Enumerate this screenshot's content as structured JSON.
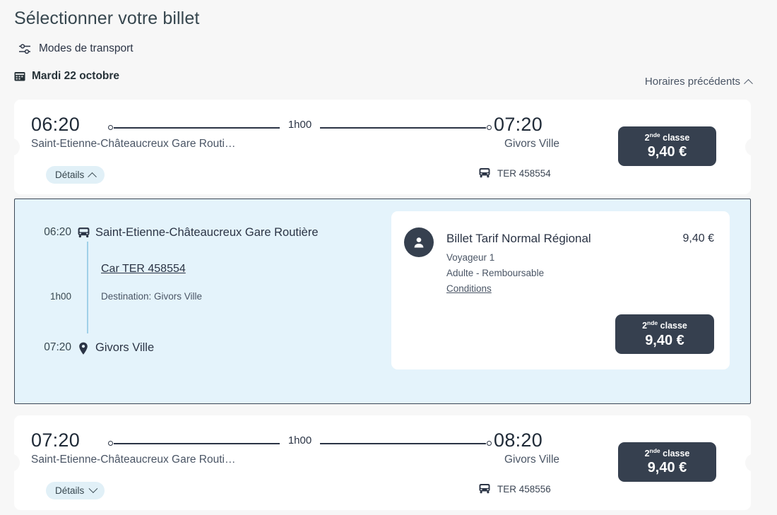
{
  "header": {
    "title": "Sélectionner votre billet",
    "transport_modes_label": "Modes de transport",
    "transport_modes_icon": "sliders-icon",
    "date_label": "Mardi 22 octobre",
    "date_icon": "calendar-icon",
    "prev_schedules_label": "Horaires précédents",
    "prev_schedules_icon": "chevron-up-icon"
  },
  "colors": {
    "page_background": "#f7f7f7",
    "card_background": "#ffffff",
    "expanded_background": "#e4f3fb",
    "expanded_border": "#3b4756",
    "price_badge": "#36404f",
    "details_chip": "#e1f0f7",
    "timeline_line": "#9fd0e8",
    "text_primary": "#2b3445",
    "text_secondary": "#4a5565"
  },
  "journeys": [
    {
      "departure_time": "06:20",
      "departure_station": "Saint-Etienne-Châteaucreux Gare Routi…",
      "arrival_time": "07:20",
      "arrival_station": "Givors Ville",
      "duration": "1h00",
      "details_label": "Détails",
      "details_expanded": true,
      "train_number": "TER 458554",
      "train_icon": "bus-icon",
      "price_class": "2",
      "price_class_sup": "nde",
      "price_class_suffix": " classe",
      "price": "9,40 €"
    },
    {
      "departure_time": "07:20",
      "departure_station": "Saint-Etienne-Châteaucreux Gare Routi…",
      "arrival_time": "08:20",
      "arrival_station": "Givors Ville",
      "duration": "1h00",
      "details_label": "Détails",
      "details_expanded": false,
      "train_number": "TER 458556",
      "train_icon": "bus-icon",
      "price_class": "2",
      "price_class_sup": "nde",
      "price_class_suffix": " classe",
      "price": "9,40 €"
    }
  ],
  "expanded_detail": {
    "departure_time": "06:20",
    "departure_station": "Saint-Etienne-Châteaucreux Gare Routière",
    "departure_icon": "bus-icon",
    "train_link": "Car TER 458554",
    "destination_label": "Destination: Givors Ville",
    "duration": "1h00",
    "arrival_time": "07:20",
    "arrival_station": "Givors Ville",
    "arrival_icon": "map-pin-icon",
    "offer": {
      "avatar_icon": "person-icon",
      "title": "Billet Tarif Normal Régional",
      "price": "9,40 €",
      "traveller": "Voyageur 1",
      "fare_type": "Adulte - Remboursable",
      "conditions_label": "Conditions",
      "badge_class": "2",
      "badge_class_sup": "nde",
      "badge_class_suffix": " classe",
      "badge_price": "9,40 €"
    }
  }
}
